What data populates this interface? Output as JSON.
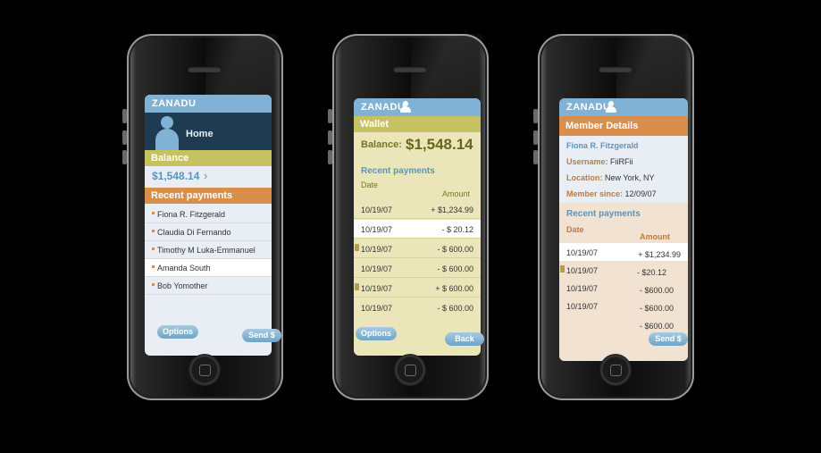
{
  "app": {
    "brand": "ZANADU"
  },
  "colors": {
    "blue_header": "#7fb2d4",
    "olive": "#c6c261",
    "orange": "#d98f4c",
    "wallet_bg": "#ebe6b9",
    "member_pay_bg": "#f2e2d2"
  },
  "home": {
    "title": "Home",
    "balance_header": "Balance",
    "balance_value": "$1,548.14",
    "balance_arrow": "›",
    "recent_header": "Recent payments",
    "recipients": [
      "Fiona R. Fitzgerald",
      "Claudia Di Fernando",
      "Timothy M Luka-Emmanuel",
      "Amanda South",
      "Bob Yomother"
    ],
    "selected_index": 3,
    "options_label": "Options",
    "send_label": "Send $"
  },
  "wallet": {
    "title": "Wallet",
    "balance_label": "Balance:",
    "balance_value": "$1,548.14",
    "recent_header": "Recent payments",
    "col_date": "Date",
    "col_amount": "Amount",
    "rows": [
      {
        "date": "10/19/07",
        "amount": "+ $1,234.99"
      },
      {
        "date": "10/19/07",
        "amount": "- $ 20.12"
      },
      {
        "date": "10/19/07",
        "amount": "- $ 600.00"
      },
      {
        "date": "10/19/07",
        "amount": "- $ 600.00"
      },
      {
        "date": "10/19/07",
        "amount": "+ $ 600.00"
      },
      {
        "date": "10/19/07",
        "amount": "- $ 600.00"
      }
    ],
    "options_label": "Options",
    "back_label": "Back"
  },
  "member": {
    "title": "Member Details",
    "name": "Fiona R. Fitzgerald",
    "username_label": "Username:",
    "username_value": "FiiRFii",
    "location_label": "Location:",
    "location_value": "New York, NY",
    "since_label": "Member since:",
    "since_value": "12/09/07",
    "recent_header": "Recent payments",
    "col_date": "Date",
    "col_amount": "Amount",
    "rows": [
      {
        "date": "10/19/07",
        "amount": "+ $1,234.99"
      },
      {
        "date": "10/19/07",
        "amount": "- $20.12"
      },
      {
        "date": "10/19/07",
        "amount": "- $600.00"
      },
      {
        "date": "10/19/07",
        "amount": "- $600.00"
      },
      {
        "date": "",
        "amount": "- $600.00"
      }
    ],
    "send_label": "Send $"
  }
}
